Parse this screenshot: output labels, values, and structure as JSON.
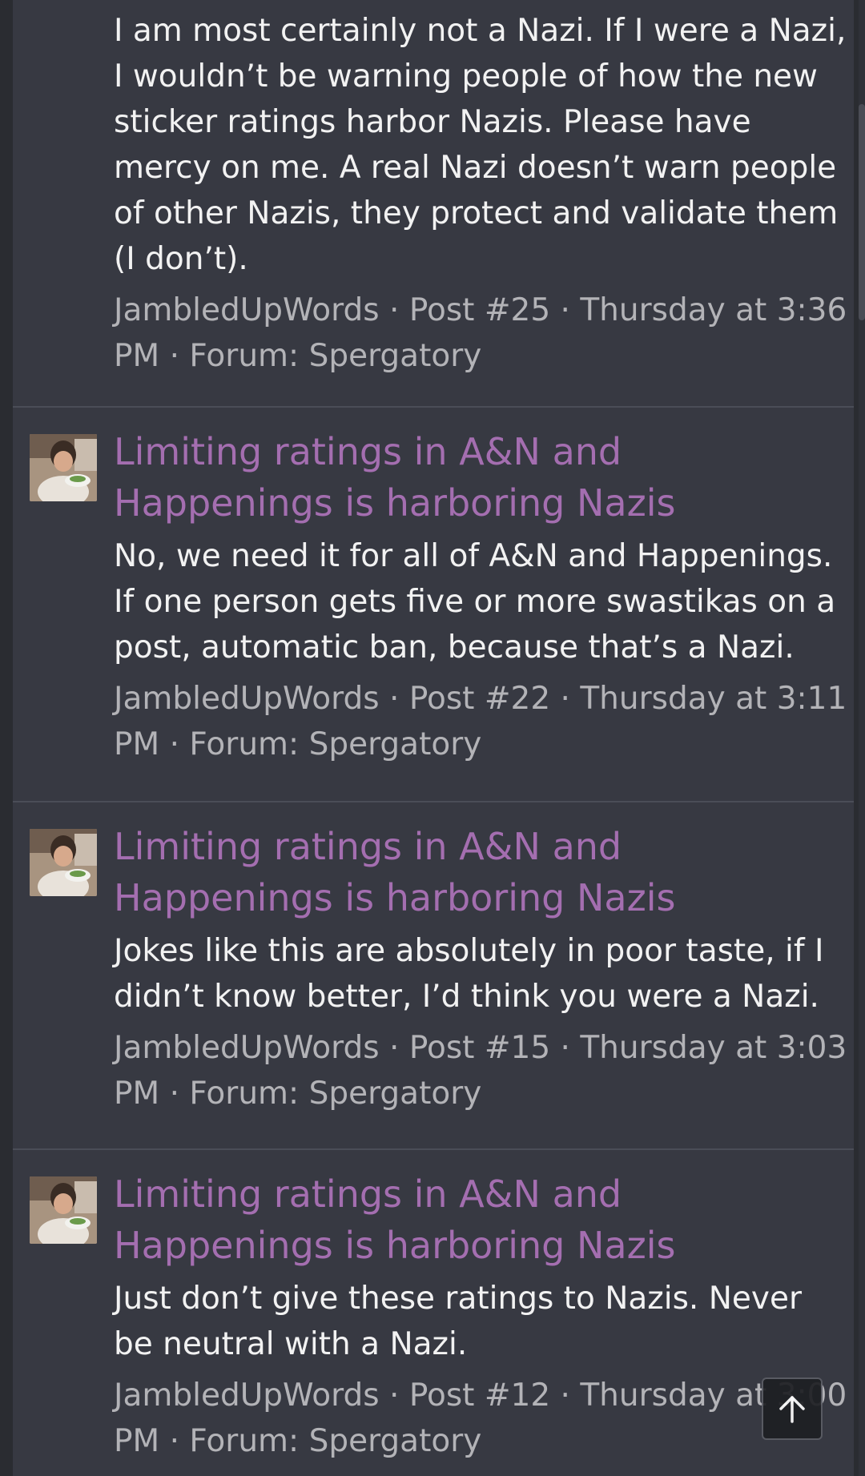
{
  "results": [
    {
      "title": "",
      "snippet": "I am most certainly not a Nazi. If I were a Nazi, I wouldn’t be warning people of how the new sticker ratings harbor Nazis. Please have mercy on me. A real Nazi doesn’t warn people of other Nazis, they protect and validate them (I don’t).",
      "user": "JambledUpWords",
      "post": "Post #25",
      "date": "Thursday at 3:36 PM",
      "forum": "Forum: Spergatory"
    },
    {
      "title": "Limiting ratings in A&N and Happenings is harboring Nazis",
      "snippet": "No, we need it for all of A&N and Happenings. If one person gets five or more swastikas on a post, automatic ban, because that’s a Nazi.",
      "user": "JambledUpWords",
      "post": "Post #22",
      "date": "Thursday at 3:11 PM",
      "forum": "Forum: Spergatory"
    },
    {
      "title": "Limiting ratings in A&N and Happenings is harboring Nazis",
      "snippet": "Jokes like this are absolutely in poor taste, if I didn’t know better, I’d think you were a Nazi.",
      "user": "JambledUpWords",
      "post": "Post #15",
      "date": "Thursday at 3:03 PM",
      "forum": "Forum: Spergatory"
    },
    {
      "title": "Limiting ratings in A&N and Happenings is harboring Nazis",
      "snippet": "Just don’t give these ratings to Nazis. Never be neutral with a Nazi.",
      "user": "JambledUpWords",
      "post": "Post #12",
      "date": "Thursday at 3:00 PM",
      "forum": "Forum: Spergatory"
    }
  ],
  "separator": "·",
  "colors": {
    "background": "#2a2c31",
    "panel": "#373942",
    "title_link": "#a46eb0",
    "snippet_text": "#f2f2f2",
    "meta_text": "#b3b3b7"
  },
  "icons": {
    "scroll_top": "arrow-up-icon"
  }
}
